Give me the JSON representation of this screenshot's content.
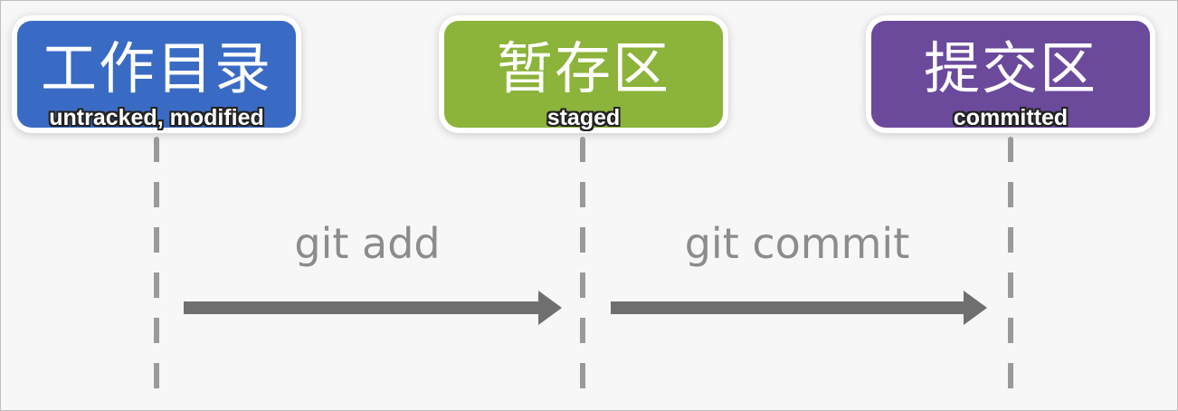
{
  "stages": [
    {
      "title": "工作目录",
      "state": "untracked, modified",
      "color": "#3a6bc4"
    },
    {
      "title": "暂存区",
      "state": "staged",
      "color": "#8cb33a"
    },
    {
      "title": "提交区",
      "state": "committed",
      "color": "#6b4a9c"
    }
  ],
  "transitions": [
    {
      "label": "git add"
    },
    {
      "label": "git commit"
    }
  ],
  "colors": {
    "arrow": "#6f6f6f",
    "dash": "#9a9a9a",
    "command_text": "#8c8c8c"
  }
}
